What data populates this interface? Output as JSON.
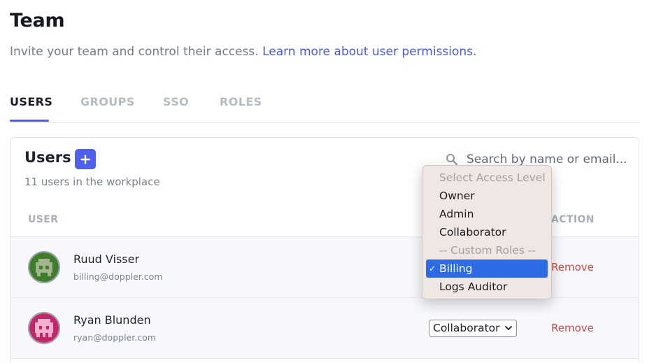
{
  "header": {
    "title": "Team",
    "subtitle": "Invite your team and control their access.",
    "learn_more_link": "Learn more about user permissions."
  },
  "tabs": [
    {
      "label": "USERS",
      "active": true
    },
    {
      "label": "GROUPS",
      "active": false
    },
    {
      "label": "SSO",
      "active": false
    },
    {
      "label": "ROLES",
      "active": false
    }
  ],
  "users_card": {
    "title": "Users",
    "count_text": "11 users in the workplace",
    "search_placeholder": "Search by name or email...",
    "columns": {
      "user": "USER",
      "action": "ACTION"
    },
    "rows": [
      {
        "name": "Ruud Visser",
        "email": "billing@doppler.com",
        "role": "Billing",
        "remove_label": "Remove",
        "avatar_color": "#3f7d2a"
      },
      {
        "name": "Ryan Blunden",
        "email": "ryan@doppler.com",
        "role": "Collaborator",
        "remove_label": "Remove",
        "avatar_color": "#c2276b"
      }
    ]
  },
  "role_dropdown": {
    "options": [
      {
        "label": "Select Access Level",
        "disabled": true
      },
      {
        "label": "Owner"
      },
      {
        "label": "Admin"
      },
      {
        "label": "Collaborator"
      },
      {
        "label": "-- Custom Roles --",
        "disabled": true
      },
      {
        "label": "Billing",
        "selected": true
      },
      {
        "label": "Logs Auditor"
      }
    ],
    "check_mark": "✓"
  },
  "colors": {
    "accent": "#4e5ee4",
    "remove": "#d64546",
    "selected_option": "#2d6ae5"
  },
  "icons": [
    "plus-icon",
    "search-icon",
    "chevron-down-icon",
    "checkmark-icon"
  ]
}
